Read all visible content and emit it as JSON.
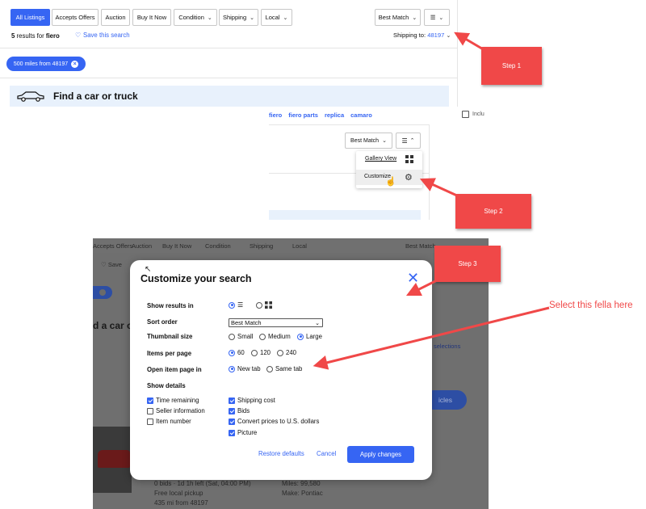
{
  "panel1": {
    "tabs": [
      {
        "label": "All Listings",
        "active": true
      },
      {
        "label": "Accepts Offers",
        "active": false
      },
      {
        "label": "Auction",
        "active": false
      },
      {
        "label": "Buy It Now",
        "active": false
      }
    ],
    "filters": {
      "condition": "Condition",
      "shipping": "Shipping",
      "local": "Local"
    },
    "sort_label": "Best Match",
    "results_count": "5",
    "results_text": "results for",
    "query": "fiero",
    "save_search": "Save this search",
    "shipping_to_label": "Shipping to:",
    "shipping_zip": "48197",
    "chip_label": "500 miles from 48197",
    "find_car_title": "Find a car or truck"
  },
  "panel2": {
    "related_links": [
      "fiero",
      "fiero parts",
      "replica",
      "camaro"
    ],
    "include_label": "Inclu",
    "sort_label": "Best Match",
    "menu": {
      "gallery_view": "Gallery View",
      "customize": "Customize"
    }
  },
  "panel3_background": {
    "topbar": [
      "Accepts Offers",
      "Auction",
      "Buy It Now",
      "Condition",
      "Shipping",
      "Local",
      "Best Match"
    ],
    "save_partial": "Save",
    "find_car_partial": "d a car o",
    "selections_partial": "selections",
    "button_partial": "icles",
    "listing": {
      "line1": "0 bids · 1d 1h left (Sat, 04:00 PM)",
      "line2": "Free local pickup",
      "line3": "435 mi from 48197",
      "miles": "Miles: 99,580",
      "make": "Make: Pontiac"
    }
  },
  "modal": {
    "title": "Customize your search",
    "rows": {
      "show_results_in": "Show results in",
      "sort_order": "Sort order",
      "thumbnail_size": "Thumbnail size",
      "items_per_page": "Items per page",
      "open_item_page_in": "Open item page in",
      "show_details": "Show details"
    },
    "show_results_selected": "list",
    "sort_order_value": "Best Match",
    "thumbnail_options": [
      {
        "label": "Small",
        "selected": false
      },
      {
        "label": "Medium",
        "selected": false
      },
      {
        "label": "Large",
        "selected": true
      }
    ],
    "items_per_page_options": [
      {
        "label": "60",
        "selected": true
      },
      {
        "label": "120",
        "selected": false
      },
      {
        "label": "240",
        "selected": false
      }
    ],
    "open_item_options": [
      {
        "label": "New tab",
        "selected": true
      },
      {
        "label": "Same tab",
        "selected": false
      }
    ],
    "details_left": [
      {
        "label": "Time remaining",
        "checked": true
      },
      {
        "label": "Seller information",
        "checked": false
      },
      {
        "label": "Item number",
        "checked": false
      }
    ],
    "details_right": [
      {
        "label": "Shipping cost",
        "checked": true
      },
      {
        "label": "Bids",
        "checked": true
      },
      {
        "label": "Convert prices to U.S. dollars",
        "checked": true
      },
      {
        "label": "Picture",
        "checked": true
      }
    ],
    "restore_defaults": "Restore defaults",
    "cancel": "Cancel",
    "apply": "Apply changes"
  },
  "callouts": {
    "step1": "Step 1",
    "step2": "Step 2",
    "step3": "Step 3",
    "note": "Select this fella here"
  },
  "colors": {
    "accent": "#3665f3",
    "callout": "#f04848"
  }
}
